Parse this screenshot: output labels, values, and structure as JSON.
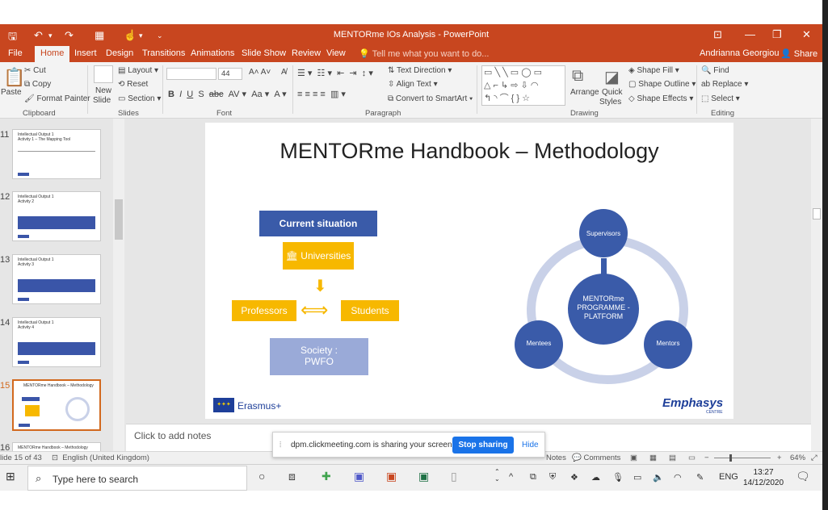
{
  "window": {
    "title": "MENTORme IOs Analysis - PowerPoint",
    "user": "Andrianna Georgiou",
    "share": "Share"
  },
  "tabs": [
    "File",
    "Home",
    "Insert",
    "Design",
    "Transitions",
    "Animations",
    "Slide Show",
    "Review",
    "View"
  ],
  "tell_me": "Tell me what you want to do...",
  "ribbon": {
    "paste": "Paste",
    "cut": "Cut",
    "copy": "Copy",
    "format_painter": "Format Painter",
    "clipboard": "Clipboard",
    "new_slide": "New",
    "new_slide_2": "Slide",
    "layout": "Layout",
    "reset": "Reset",
    "section": "Section",
    "slides": "Slides",
    "font_size": "44",
    "font": "Font",
    "text_direction": "Text Direction",
    "align_text": "Align Text",
    "convert_smartart": "Convert to SmartArt",
    "paragraph": "Paragraph",
    "arrange": "Arrange",
    "quick_styles_1": "Quick",
    "quick_styles_2": "Styles",
    "shape_fill": "Shape Fill",
    "shape_outline": "Shape Outline",
    "shape_effects": "Shape Effects",
    "drawing": "Drawing",
    "find": "Find",
    "replace": "Replace",
    "select": "Select",
    "editing": "Editing"
  },
  "thumbnails": [
    {
      "num": "11",
      "title": "Intellectual Output 1\nActivity 1 – The Mapping Tool"
    },
    {
      "num": "12",
      "title": "Intellectual Output 1\nActivity 2"
    },
    {
      "num": "13",
      "title": "Intellectual Output 1\nActivity 3"
    },
    {
      "num": "14",
      "title": "Intellectual Output 1\nActivity 4"
    },
    {
      "num": "15",
      "title": "MENTORme Handbook – Methodology"
    },
    {
      "num": "16",
      "title": "MENTORme Handbook – Methodology"
    }
  ],
  "slide": {
    "title": "MENTORme Handbook – Methodology",
    "current_situation": "Current situation",
    "universities": "Universities",
    "professors": "Professors",
    "students": "Students",
    "society": "Society :",
    "pwfo": "PWFO",
    "center": "MENTORme PROGRAMME - PLATFORM",
    "supervisors": "Supervisors",
    "mentees": "Mentees",
    "mentors": "Mentors",
    "erasmus": "Erasmus+",
    "emphasys": "Emphasys",
    "centre": "CENTRE"
  },
  "notes_placeholder": "Click to add notes",
  "status": {
    "slide_count": "lide 15 of 43",
    "language": "English (United Kingdom)",
    "notes": "Notes",
    "comments": "Comments",
    "zoom": "64%"
  },
  "share_banner": {
    "message": "dpm.clickmeeting.com is sharing your screen.",
    "stop": "Stop sharing",
    "hide": "Hide"
  },
  "taskbar": {
    "search_placeholder": "Type here to search",
    "lang": "ENG",
    "time": "13:27",
    "date": "14/12/2020"
  },
  "colors": {
    "accent": "#c8461f",
    "slide_blue": "#3a5ba9",
    "slide_yellow": "#f7b800",
    "slide_light": "#9aaad8",
    "stop_button": "#1a73e8"
  }
}
